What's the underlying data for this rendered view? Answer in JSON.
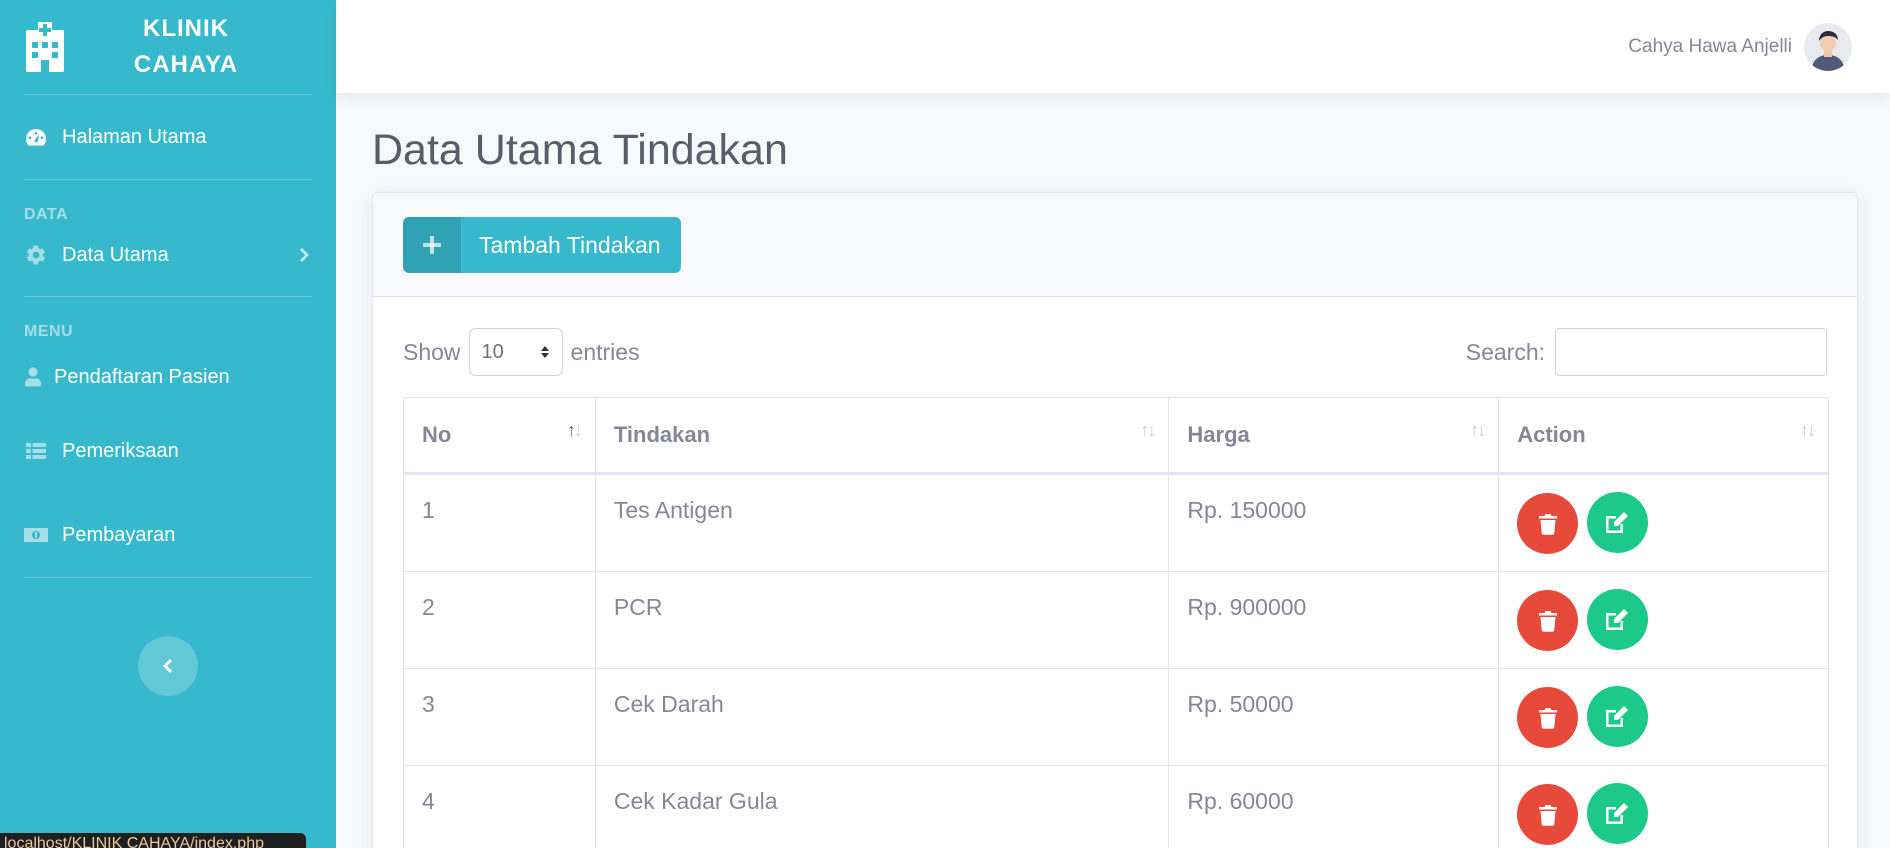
{
  "brand": {
    "line1": "KLINIK",
    "line2": "CAHAYA"
  },
  "sidebar": {
    "dashboard": "Halaman Utama",
    "heading_data": "DATA",
    "data_utama": "Data Utama",
    "heading_menu": "MENU",
    "items": [
      {
        "label": "Pendaftaran Pasien",
        "icon": "user-icon"
      },
      {
        "label": "Pemeriksaan",
        "icon": "list-icon"
      },
      {
        "label": "Pembayaran",
        "icon": "money-icon"
      }
    ]
  },
  "status_url": "localhost/KLINIK CAHAYA/index.php",
  "topbar": {
    "user_name": "Cahya Hawa Anjelli"
  },
  "page": {
    "title": "Data Utama Tindakan"
  },
  "card": {
    "add_button": "Tambah Tindakan"
  },
  "datatable": {
    "show_label": "Show",
    "entries_value": "10",
    "entries_label": "entries",
    "search_label": "Search:",
    "columns": [
      "No",
      "Tindakan",
      "Harga",
      "Action"
    ],
    "rows": [
      {
        "no": "1",
        "tindakan": "Tes Antigen",
        "harga": "Rp. 150000"
      },
      {
        "no": "2",
        "tindakan": "PCR",
        "harga": "Rp. 900000"
      },
      {
        "no": "3",
        "tindakan": "Cek Darah",
        "harga": "Rp. 50000"
      },
      {
        "no": "4",
        "tindakan": "Cek Kadar Gula",
        "harga": "Rp. 60000"
      }
    ]
  },
  "colors": {
    "primary": "#36b9cc",
    "danger": "#e74a3b",
    "success": "#1cc88a"
  }
}
